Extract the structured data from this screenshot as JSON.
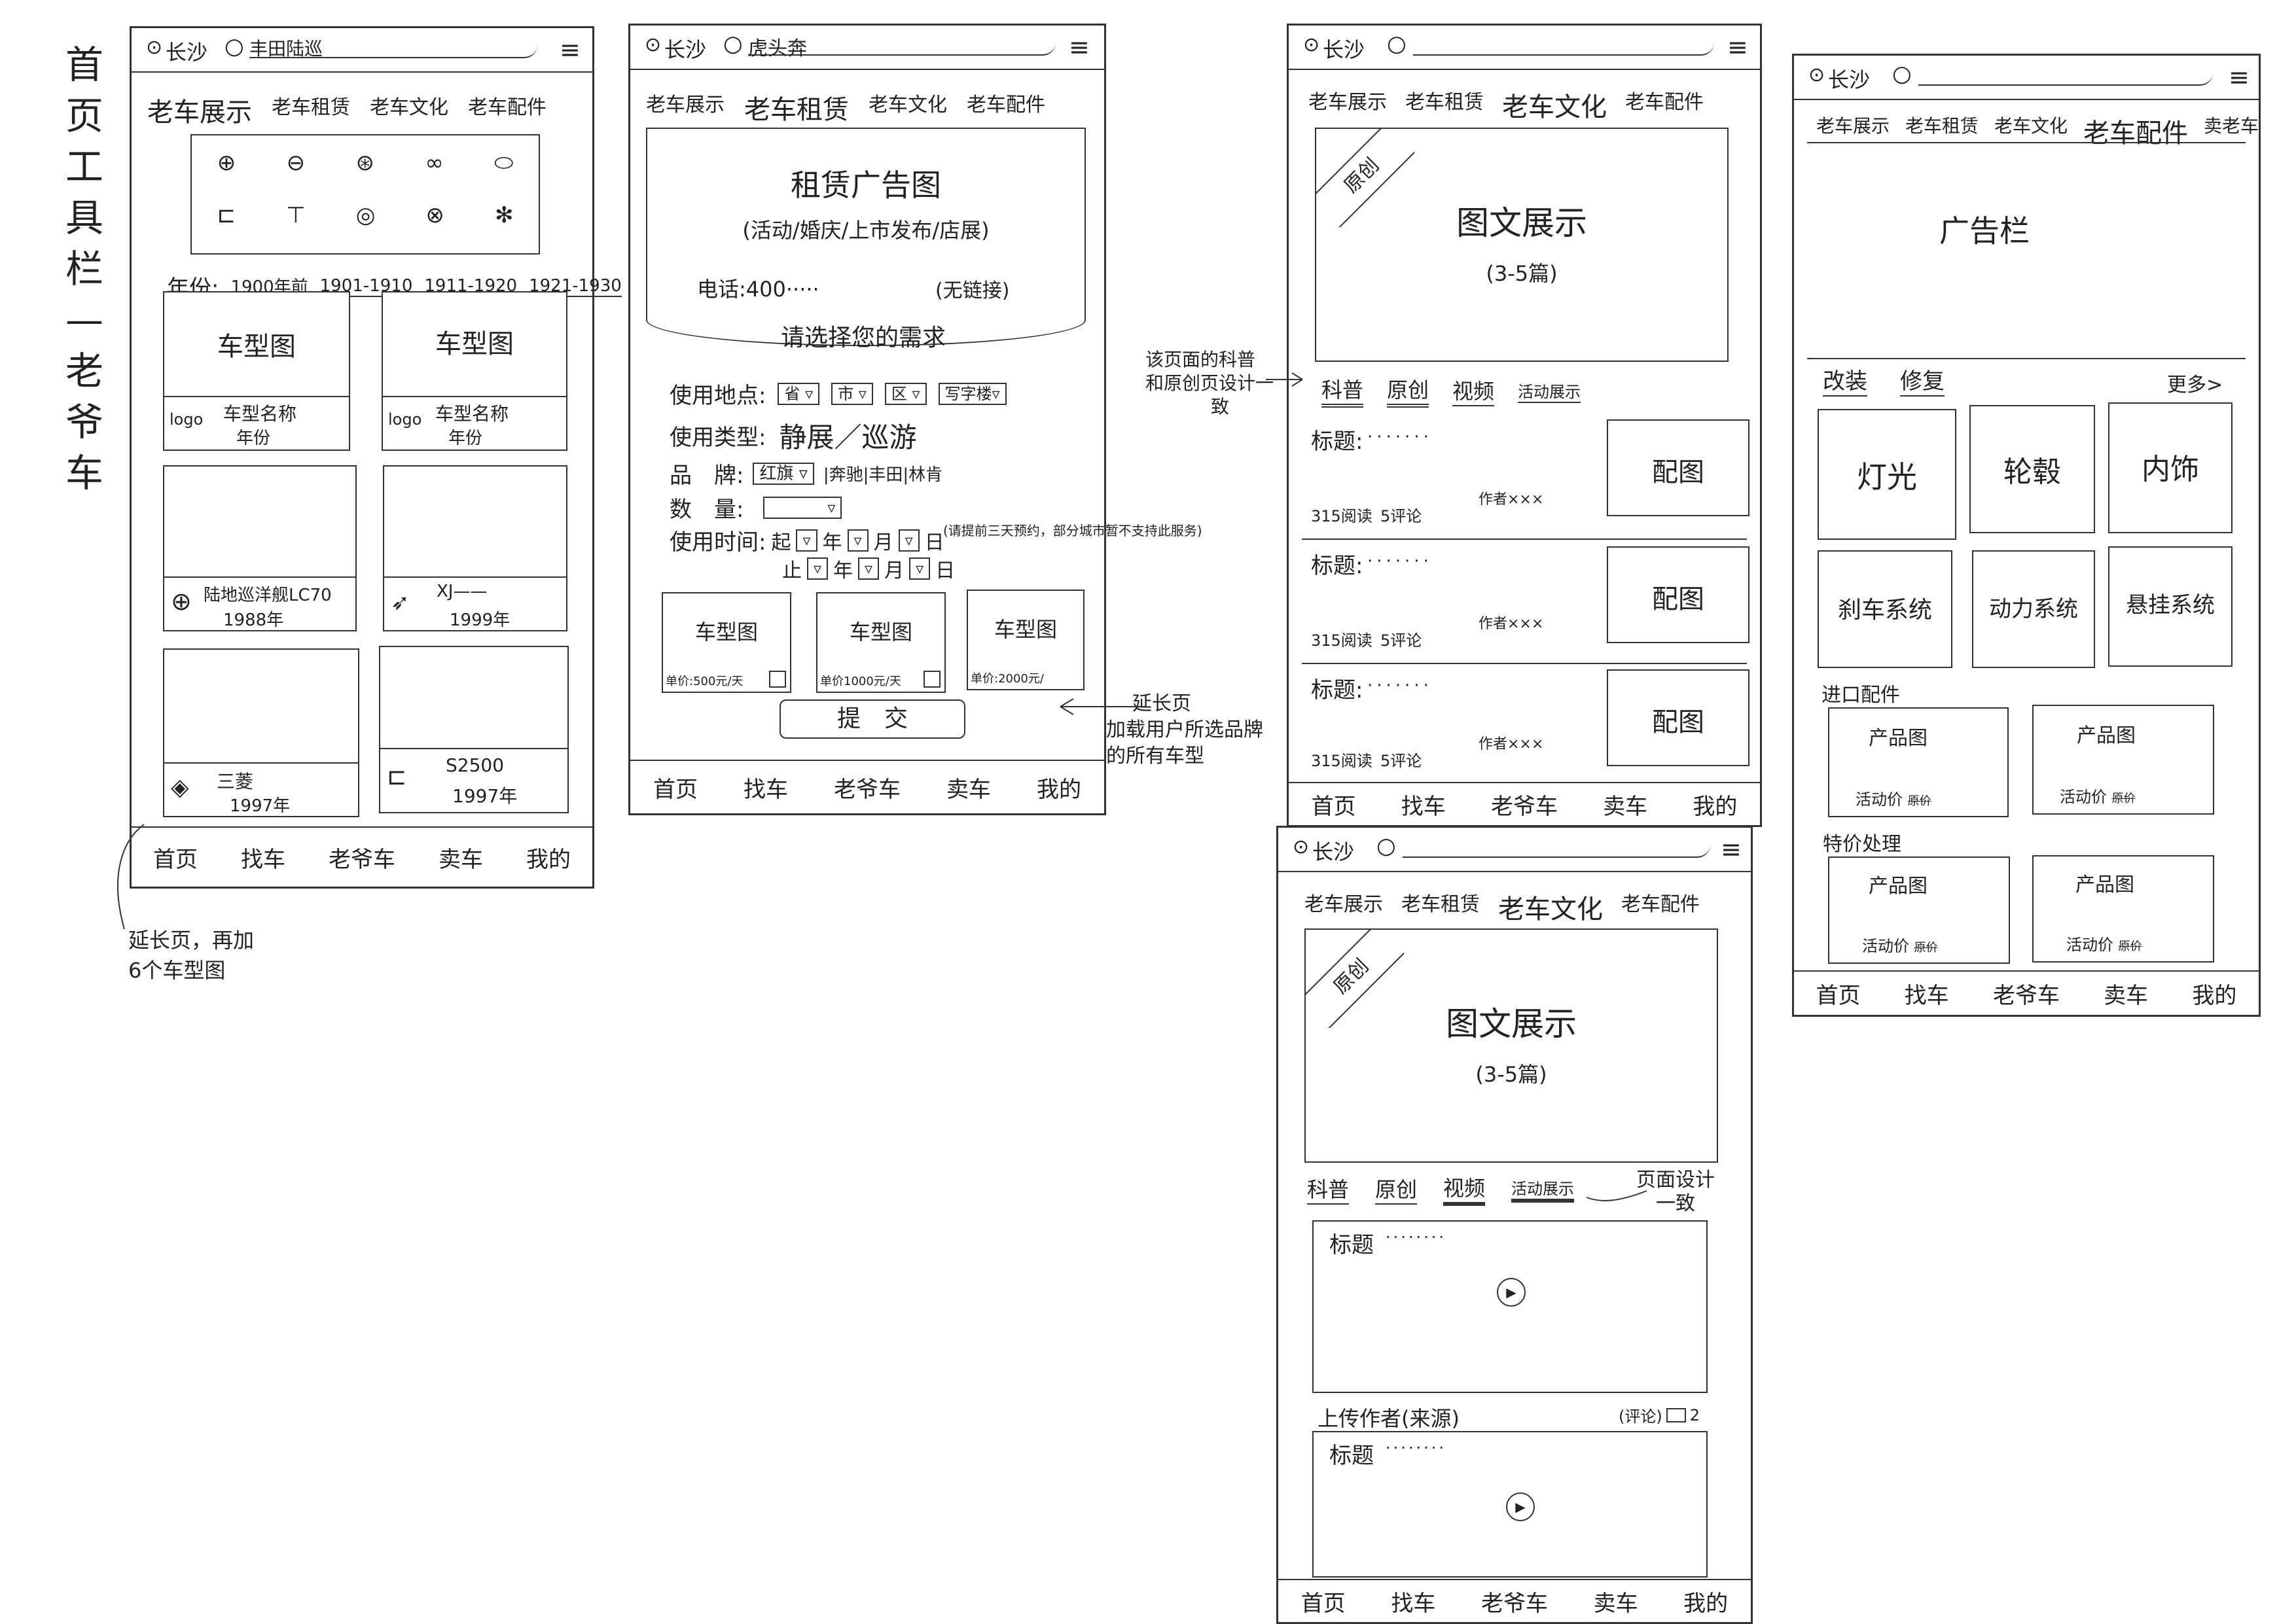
{
  "side_title": "首页工具栏—老爷车",
  "common": {
    "city": "长沙",
    "tabs": [
      "首页",
      "找车",
      "老爷车",
      "卖车",
      "我的"
    ]
  },
  "p1": {
    "search": "丰田陆巡",
    "nav": [
      "老车展示",
      "老车租赁",
      "老车文化",
      "老车配件"
    ],
    "year_label": "年份:",
    "years": [
      "1900年前",
      "1901-1910",
      "1911-1920",
      "1921-1930"
    ],
    "cards": [
      {
        "img": "车型图",
        "logo": "logo",
        "name": "车型名称",
        "year": "年份"
      },
      {
        "img": "车型图",
        "logo": "logo",
        "name": "车型名称",
        "year": "年份"
      },
      {
        "img": "",
        "logo": "",
        "name": "陆地巡洋舰LC70",
        "year": "1988年"
      },
      {
        "img": "",
        "logo": "",
        "name": "XJ——",
        "year": "1999年"
      },
      {
        "img": "",
        "logo": "",
        "name": "三菱",
        "year": "1997年"
      },
      {
        "img": "",
        "logo": "",
        "name": "S2500",
        "year": "1997年"
      }
    ],
    "note": [
      "延长页，再加",
      "6个车型图"
    ]
  },
  "p2": {
    "search": "虎头奔",
    "nav": [
      "老车展示",
      "老车租赁",
      "老车文化",
      "老车配件"
    ],
    "ad_title": "租赁广告图",
    "ad_sub": "(活动/婚庆/上市发布/店展)",
    "phone": "电话:400·····",
    "no_link": "(无链接)",
    "prompt": "请选择您的需求",
    "addr_label": "使用地点:",
    "addr": [
      "省",
      "市",
      "区",
      "写字楼"
    ],
    "type_label": "使用类型:",
    "type_value": "静展／巡游",
    "brand_label": "品　牌:",
    "brand_value": "红旗",
    "brand_others": "|奔驰|丰田|林肯",
    "qty_label": "数　量:",
    "time_label": "使用时间:",
    "time_start": "起",
    "time_end": "止",
    "time_units": [
      "年",
      "月",
      "日"
    ],
    "time_note": "(请提前三天预约，部分城市暂不支持此服务)",
    "cars": [
      {
        "img": "车型图",
        "price": "单价:500元/天"
      },
      {
        "img": "车型图",
        "price": "单价1000元/天"
      },
      {
        "img": "车型图",
        "price": "单价:2000元/"
      }
    ],
    "submit": "提　交",
    "note": [
      "延长页",
      "加载用户所选品牌",
      "的所有车型"
    ]
  },
  "p3": {
    "nav": [
      "老车展示",
      "老车租赁",
      "老车文化",
      "老车配件"
    ],
    "badge": "原创",
    "banner": "图文展示",
    "banner_sub": "(3-5篇)",
    "subtabs": [
      "科普",
      "原创",
      "视频",
      "活动展示"
    ],
    "annotation": [
      "该页面的科普",
      "和原创页设计一",
      "致"
    ],
    "articles": [
      {
        "title": "标题:",
        "reads": "315阅读",
        "comments": "5评论",
        "author": "作者×××",
        "img": "配图"
      },
      {
        "title": "标题:",
        "reads": "315阅读",
        "comments": "5评论",
        "author": "作者×××",
        "img": "配图"
      },
      {
        "title": "标题:",
        "reads": "315阅读",
        "comments": "5评论",
        "author": "作者×××",
        "img": "配图"
      }
    ]
  },
  "p4": {
    "nav": [
      "老车展示",
      "老车租赁",
      "老车文化",
      "老车配件"
    ],
    "badge": "原创",
    "banner": "图文展示",
    "banner_sub": "(3-5篇)",
    "subtabs": [
      "科普",
      "原创",
      "视频",
      "活动展示"
    ],
    "annotation": [
      "页面设计",
      "一致"
    ],
    "videos": [
      {
        "title": "标题"
      },
      {
        "title": "标题"
      }
    ],
    "uploader": "上传作者(来源)",
    "comment": "(评论)",
    "comment_count": "2"
  },
  "p5": {
    "nav": [
      "老车展示",
      "老车租赁",
      "老车文化",
      "老车配件",
      "卖老车"
    ],
    "ad": "广告栏",
    "sections": [
      "改装",
      "修复"
    ],
    "more": "更多>",
    "categories": [
      "灯光",
      "轮毂",
      "内饰",
      "刹车系统",
      "动力系统",
      "悬挂系统"
    ],
    "import_label": "进口配件",
    "special_label": "特价处理",
    "product_img": "产品图",
    "product_price": "活动价",
    "product_orig": "原价"
  }
}
